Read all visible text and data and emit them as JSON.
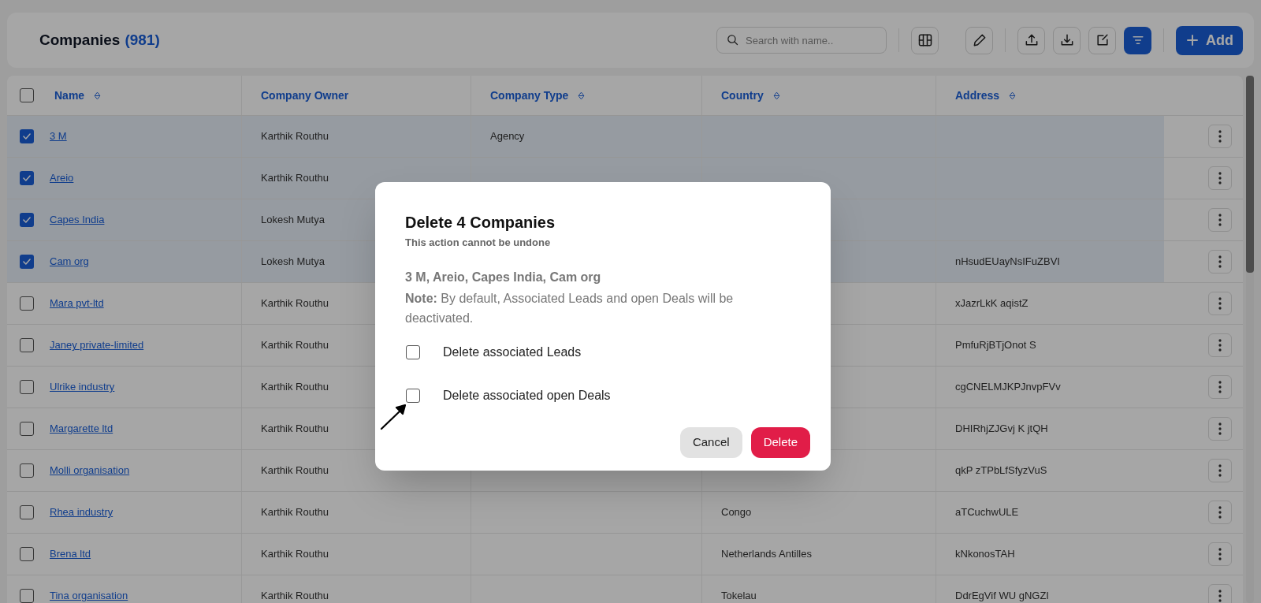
{
  "header": {
    "title": "Companies",
    "count": "(981)",
    "search": {
      "placeholder": "Search with name.."
    },
    "toolbar": [
      [
        {
          "kind": "columns",
          "active": false
        },
        {
          "kind": "edit",
          "active": false
        }
      ],
      [
        {
          "kind": "upload",
          "active": false
        },
        {
          "kind": "download",
          "active": false
        },
        {
          "kind": "note",
          "active": false
        },
        {
          "kind": "filter",
          "active": true
        }
      ]
    ],
    "add_button": {
      "label": "Add"
    }
  },
  "table": {
    "select_all": {
      "checked": false
    },
    "columns": [
      {
        "label": "Name",
        "sortable": true
      },
      {
        "label": "Company Owner",
        "sortable": false
      },
      {
        "label": "Company Type",
        "sortable": true
      },
      {
        "label": "Country",
        "sortable": true
      },
      {
        "label": "Address",
        "sortable": true
      }
    ],
    "rows": [
      {
        "name": "3 M",
        "owner": "Karthik Routhu",
        "type": "Agency",
        "selected": true
      },
      {
        "name": "Areio",
        "owner": "Karthik Routhu",
        "selected": true
      },
      {
        "name": "Capes India",
        "owner": "Lokesh Mutya",
        "selected": true
      },
      {
        "name": "Cam org",
        "owner": "Lokesh Mutya",
        "address": "nHsudEUayNsIFuZBVI",
        "selected": true
      },
      {
        "name": "Mara pvt-ltd",
        "owner": "Karthik Routhu",
        "address": "xJazrLkK aqistZ",
        "selected": false
      },
      {
        "name": "Janey private-limited",
        "owner": "Karthik Routhu",
        "address": "PmfuRjBTjOnot S",
        "selected": false
      },
      {
        "name": "Ulrike industry",
        "owner": "Karthik Routhu",
        "address": "cgCNELMJKPJnvpFVv",
        "selected": false
      },
      {
        "name": "Margarette ltd",
        "owner": "Karthik Routhu",
        "address": "DHIRhjZJGvj K jtQH",
        "selected": false
      },
      {
        "name": "Molli organisation",
        "owner": "Karthik Routhu",
        "address": "qkP zTPbLfSfyzVuS",
        "selected": false
      },
      {
        "name": "Rhea industry",
        "owner": "Karthik Routhu",
        "country": "Congo",
        "address": "aTCuchwULE",
        "selected": false
      },
      {
        "name": "Brena ltd",
        "owner": "Karthik Routhu",
        "country": "Netherlands Antilles",
        "address": "kNkonosTAH",
        "selected": false
      },
      {
        "name": "Tina organisation",
        "owner": "Karthik Routhu",
        "country": "Tokelau",
        "address": "DdrEgVif WU gNGZI",
        "selected": false
      }
    ]
  },
  "dialog": {
    "title": "Delete 4 Companies",
    "subtitle": "This action cannot be undone",
    "names": "3 M, Areio, Capes India, Cam org",
    "note": "**Note:** By default, Associated Leads and open Deals will be deactivated.",
    "options": [
      {
        "label": "Delete associated Leads",
        "checked": false
      },
      {
        "label": "Delete associated open Deals",
        "checked": false
      }
    ],
    "buttons": [
      {
        "kind": "cancel",
        "label": "Cancel"
      },
      {
        "kind": "danger",
        "label": "Delete"
      }
    ]
  }
}
